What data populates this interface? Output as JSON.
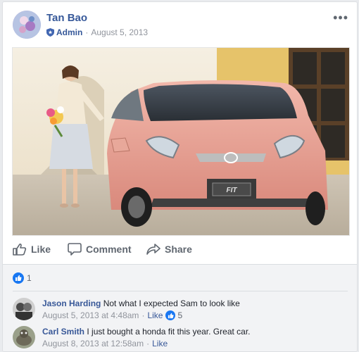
{
  "post": {
    "author": "Tan Bao",
    "role": "Admin",
    "date": "August 5, 2013",
    "more_icon": "ellipsis-icon"
  },
  "photo": {
    "plate_text": "FIT"
  },
  "actions": {
    "like": "Like",
    "comment": "Comment",
    "share": "Share"
  },
  "reactions": {
    "count": "1"
  },
  "comments": [
    {
      "name": "Jason Harding",
      "text": "Not what I expected Sam to look like",
      "time": "August 5, 2013 at 4:48am",
      "like": "Like",
      "likes": "5"
    },
    {
      "name": "Carl Smith",
      "text": "I just bought a honda fit this year. Great car.",
      "time": "August 8, 2013 at 12:58am",
      "like": "Like"
    }
  ],
  "colors": {
    "link": "#365899",
    "muted": "#90949c",
    "like_blue": "#1877f2",
    "car_pink": "#e8a89a"
  }
}
